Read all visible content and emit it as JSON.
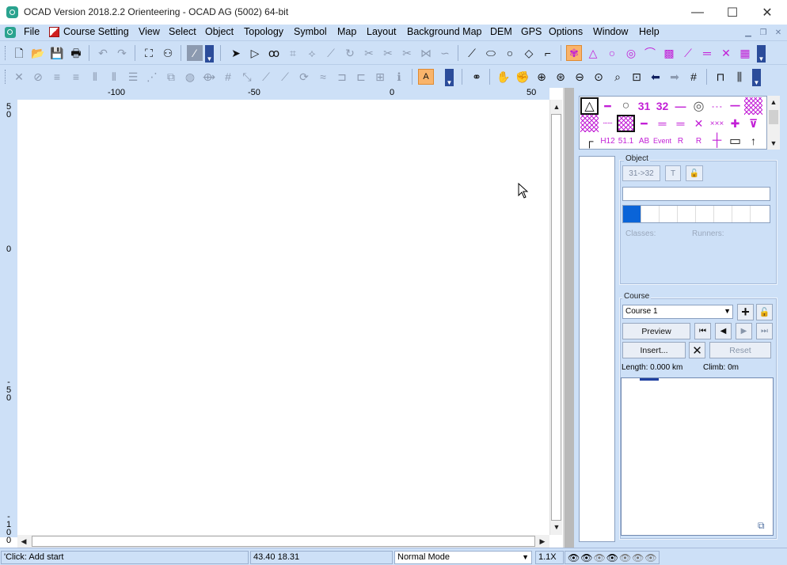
{
  "window": {
    "title": "OCAD Version 2018.2.2  Orienteering - OCAD AG (5002) 64-bit",
    "minimize_icon": "minimize-icon",
    "maximize_icon": "maximize-icon",
    "close_icon": "close-icon"
  },
  "menu": {
    "items": [
      "File",
      "Course Setting",
      "View",
      "Select",
      "Object",
      "Topology",
      "Symbol",
      "Map",
      "Layout",
      "Background Map",
      "DEM",
      "GPS",
      "Options",
      "Window",
      "Help"
    ]
  },
  "ruler": {
    "top_labels": [
      "-100",
      "-50",
      "0",
      "50"
    ],
    "left_labels": [
      [
        "5",
        "0"
      ],
      [
        "0"
      ],
      [
        "-",
        "5",
        "0"
      ],
      [
        "-",
        "1",
        "0",
        "0"
      ]
    ]
  },
  "symbols": {
    "row1": [
      "△",
      "━",
      "○",
      "31",
      "32",
      "—",
      "◎",
      "- - -",
      "━━",
      "▦"
    ],
    "row2": [
      "▦",
      "┄┄",
      "▦",
      "━",
      "═",
      "═",
      "✕",
      "×××",
      "✚",
      "⊽"
    ],
    "row3": [
      "┌",
      "H12",
      "51.1",
      "AB",
      "Event",
      "R",
      "R",
      "┼",
      "▭",
      "↑"
    ]
  },
  "object_panel": {
    "title": "Object",
    "code_button": "31->32",
    "text_button": "T",
    "classes_label": "Classes:",
    "runners_label": "Runners:"
  },
  "course_panel": {
    "title": "Course",
    "selected_course": "Course 1",
    "preview_button": "Preview",
    "insert_button": "Insert...",
    "reset_button": "Reset",
    "length_text": "Length: 0.000 km",
    "climb_text": "Climb: 0m"
  },
  "status": {
    "hint": "'Click: Add start",
    "coordinates": "43.40   18.31",
    "mode": "Normal Mode",
    "zoom": "1.1X"
  },
  "colors": {
    "chrome": "#cde0f7",
    "symbol_purple": "#c21fd6",
    "active_tool": "#f9b46b",
    "selected_color": "#0a64d8"
  }
}
